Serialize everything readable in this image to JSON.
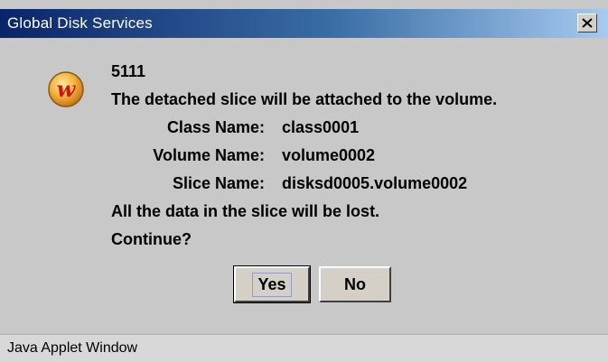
{
  "window": {
    "title": "Global Disk Services"
  },
  "icons": {
    "app_icon": "gds-logo-icon",
    "close_icon": "close-icon"
  },
  "message": {
    "code": "5111",
    "text": "The detached slice will be attached to the volume.",
    "details": [
      {
        "label": "Class Name:",
        "value": "class0001"
      },
      {
        "label": "Volume Name:",
        "value": "volume0002"
      },
      {
        "label": "Slice Name:",
        "value": "disksd0005.volume0002"
      }
    ],
    "warning": "All the data in the slice will be lost.",
    "question": "Continue?"
  },
  "buttons": {
    "yes_label": "Yes",
    "no_label": "No"
  },
  "status": {
    "text": "Java Applet Window"
  },
  "colors": {
    "title_bar_start": "#0a246a",
    "title_bar_end": "#a6caf0",
    "dialog_background": "#c8c8c8",
    "icon_orange": "#f0a030",
    "icon_red": "#c81818"
  }
}
